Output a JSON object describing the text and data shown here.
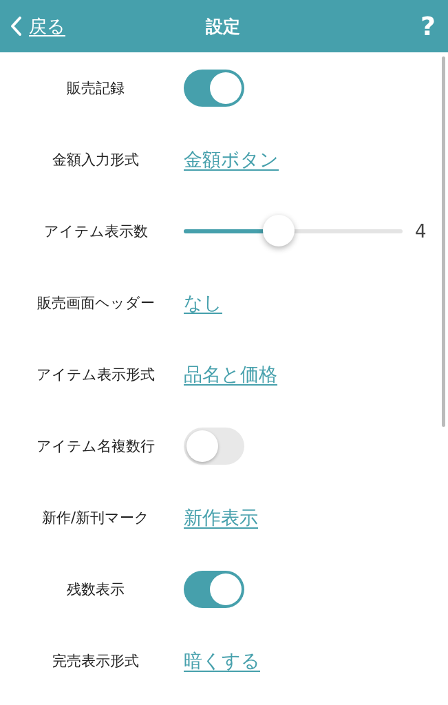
{
  "header": {
    "back": "戻る",
    "title": "設定",
    "help": "?"
  },
  "settings": [
    {
      "label": "販売記録",
      "kind": "toggle",
      "on": true
    },
    {
      "label": "金額入力形式",
      "kind": "link",
      "value": "金額ボタン"
    },
    {
      "label": "アイテム表示数",
      "kind": "slider",
      "level": 0.435,
      "reading": "4"
    },
    {
      "label": "販売画面ヘッダー",
      "kind": "link",
      "value": "なし"
    },
    {
      "label": "アイテム表示形式",
      "kind": "link",
      "value": "品名と価格"
    },
    {
      "label": "アイテム名複数行",
      "kind": "toggle",
      "on": false
    },
    {
      "label": "新作/新刊マーク",
      "kind": "link",
      "value": "新作表示"
    },
    {
      "label": "残数表示",
      "kind": "toggle",
      "on": true
    },
    {
      "label": "完売表示形式",
      "kind": "link",
      "value": "暗くする"
    }
  ]
}
